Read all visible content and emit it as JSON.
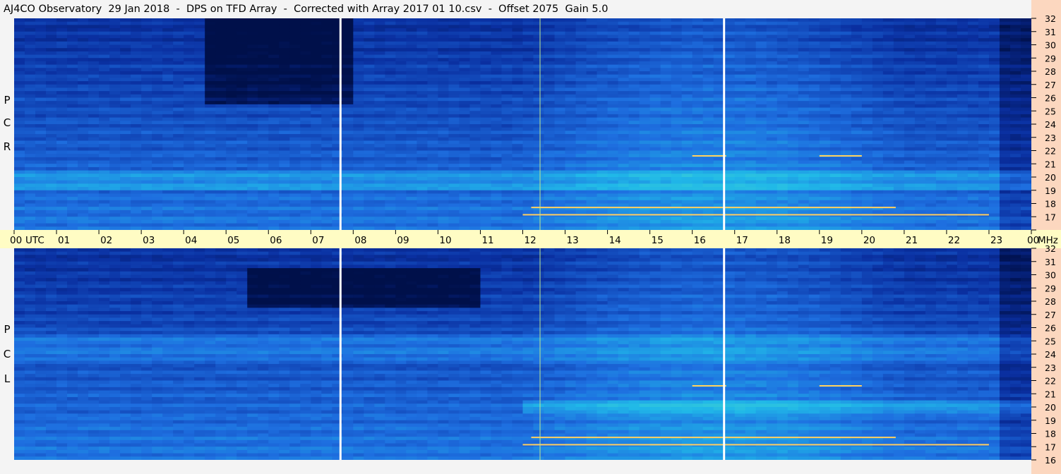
{
  "title": "AJ4CO Observatory  29 Jan 2018  -  DPS on TFD Array  -  Corrected with Array 2017 01 10.csv  -  Offset 2075  Gain 5.0",
  "chart_data": {
    "type": "heatmap",
    "x_axis": {
      "label": "UTC",
      "ticks": [
        "00",
        "01",
        "02",
        "03",
        "04",
        "05",
        "06",
        "07",
        "08",
        "09",
        "10",
        "11",
        "12",
        "13",
        "14",
        "15",
        "16",
        "17",
        "18",
        "19",
        "20",
        "21",
        "22",
        "23",
        "00"
      ],
      "range": [
        0,
        24
      ]
    },
    "y_axis": {
      "unit": "MHz",
      "ticks": [
        "16",
        "17",
        "18",
        "19",
        "20",
        "21",
        "22",
        "23",
        "24",
        "25",
        "26",
        "27",
        "28",
        "29",
        "30",
        "31",
        "32"
      ],
      "range": [
        16,
        32
      ]
    },
    "panels": [
      {
        "name": "R C P",
        "letters": [
          "R",
          "C",
          "P"
        ],
        "dark_region_hours": [
          4.5,
          8.0
        ],
        "dark_region_mhz": [
          25.5,
          32
        ]
      },
      {
        "name": "L C P",
        "letters": [
          "L",
          "C",
          "P"
        ],
        "dark_region_hours": [
          5.5,
          11.0
        ],
        "dark_region_mhz": [
          27.5,
          30.5
        ]
      }
    ],
    "data_gaps_utc_hours": [
      7.7,
      16.75
    ],
    "vertical_marker_utc_hours": [
      12.4
    ],
    "colormap": [
      "#00104a",
      "#0a2fa0",
      "#1e6fe0",
      "#20b8e8",
      "#4ee0c8",
      "#c8f060",
      "#ffe040",
      "#ff4a30"
    ]
  }
}
